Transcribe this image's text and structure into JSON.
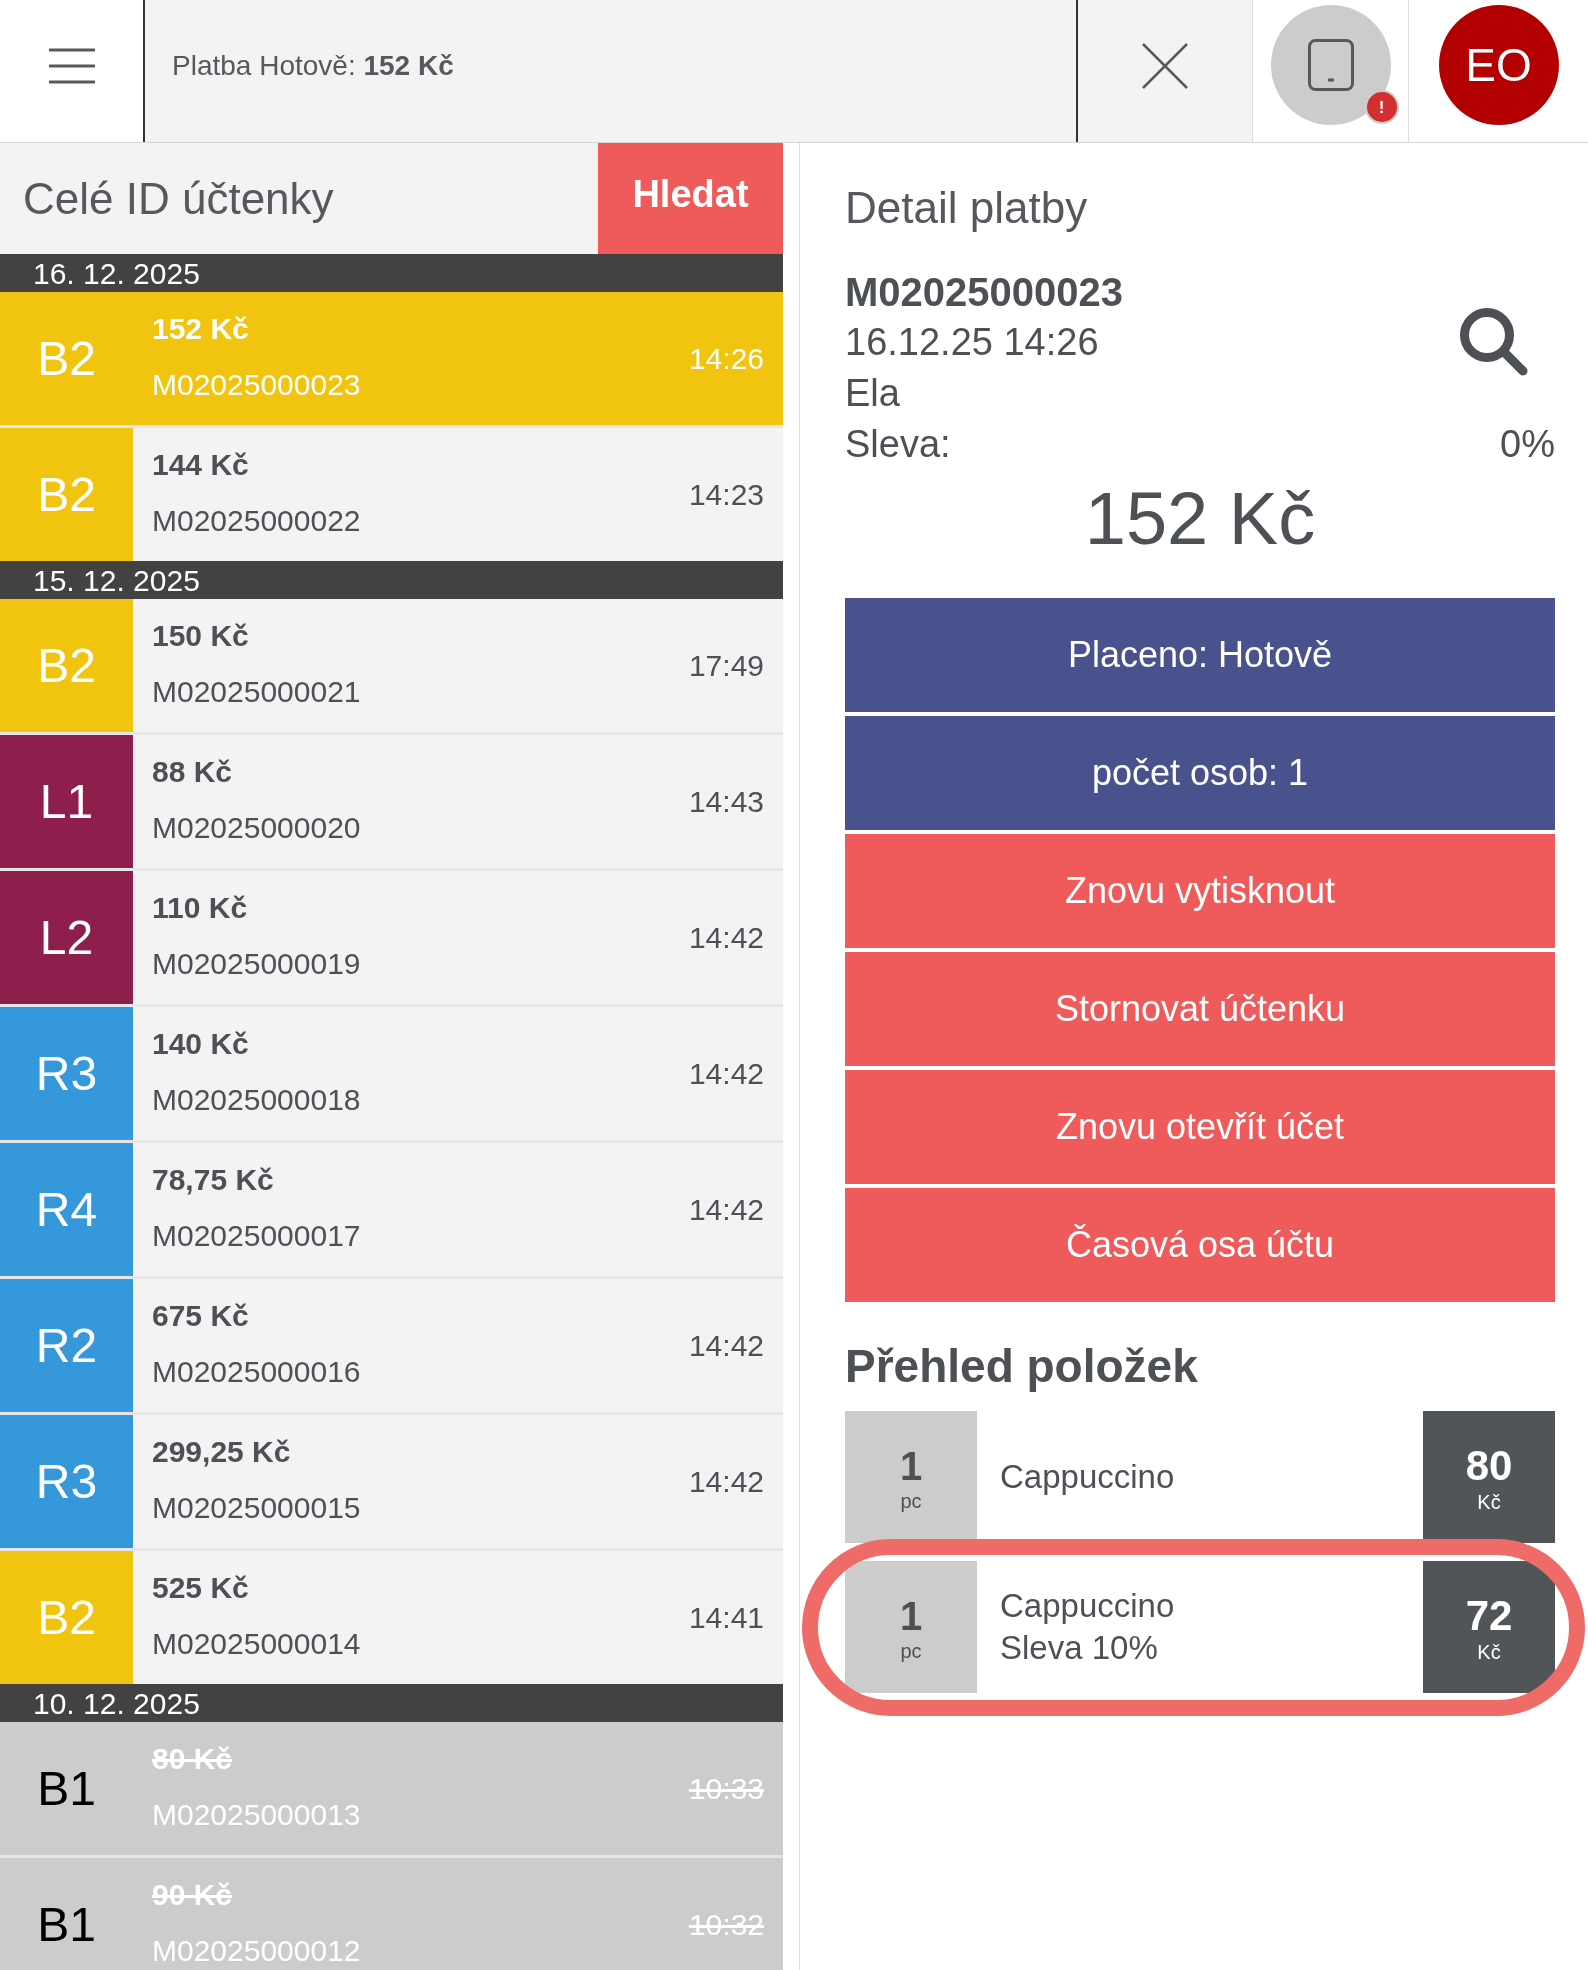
{
  "top_bar": {
    "title": "Platba Hotově: **152 Kč**",
    "device_badge": "!",
    "avatar": "EO"
  },
  "search": {
    "placeholder": "Celé ID účtenky",
    "button": "Hledat"
  },
  "receipt_groups": [
    {
      "date": "16. 12. 2025",
      "receipts": [
        {
          "table": "B2",
          "color": "#f1c40f",
          "amount": "152 Kč",
          "id": "M02025000023",
          "time": "14:26",
          "selected": true,
          "voided": false
        },
        {
          "table": "B2",
          "color": "#f1c40f",
          "amount": "144 Kč",
          "id": "M02025000022",
          "time": "14:23",
          "selected": false,
          "voided": false
        }
      ]
    },
    {
      "date": "15. 12. 2025",
      "receipts": [
        {
          "table": "B2",
          "color": "#f1c40f",
          "amount": "150 Kč",
          "id": "M02025000021",
          "time": "17:49",
          "selected": false,
          "voided": false
        },
        {
          "table": "L1",
          "color": "#8e1e4b",
          "amount": "88 Kč",
          "id": "M02025000020",
          "time": "14:43",
          "selected": false,
          "voided": false
        },
        {
          "table": "L2",
          "color": "#8e1e4b",
          "amount": "110 Kč",
          "id": "M02025000019",
          "time": "14:42",
          "selected": false,
          "voided": false
        },
        {
          "table": "R3",
          "color": "#3598db",
          "amount": "140 Kč",
          "id": "M02025000018",
          "time": "14:42",
          "selected": false,
          "voided": false
        },
        {
          "table": "R4",
          "color": "#3598db",
          "amount": "78,75 Kč",
          "id": "M02025000017",
          "time": "14:42",
          "selected": false,
          "voided": false
        },
        {
          "table": "R2",
          "color": "#3598db",
          "amount": "675 Kč",
          "id": "M02025000016",
          "time": "14:42",
          "selected": false,
          "voided": false
        },
        {
          "table": "R3",
          "color": "#3598db",
          "amount": "299,25 Kč",
          "id": "M02025000015",
          "time": "14:42",
          "selected": false,
          "voided": false
        },
        {
          "table": "B2",
          "color": "#f1c40f",
          "amount": "525 Kč",
          "id": "M02025000014",
          "time": "14:41",
          "selected": false,
          "voided": false
        }
      ]
    },
    {
      "date": "10. 12. 2025",
      "receipts": [
        {
          "table": "B1",
          "color": "#cccccc",
          "amount": "80 Kč",
          "id": "M02025000013",
          "time": "10:33",
          "selected": false,
          "voided": true
        },
        {
          "table": "B1",
          "color": "#cccccc",
          "amount": "90 Kč",
          "id": "M02025000012",
          "time": "10:32",
          "selected": false,
          "voided": true
        }
      ]
    }
  ],
  "detail": {
    "title": "Detail platby",
    "receipt_id": "M02025000023",
    "datetime": "16.12.25 14:26",
    "staff": "Ela",
    "discount_label": "Sleva:",
    "discount_value": "0%",
    "total": "152 Kč",
    "actions": [
      {
        "label": "Placeno: Hotově",
        "kind": "info"
      },
      {
        "label": "počet osob: 1",
        "kind": "info"
      },
      {
        "label": "Znovu vytisknout",
        "kind": "danger"
      },
      {
        "label": "Stornovat účtenku",
        "kind": "danger"
      },
      {
        "label": "Znovu otevřít účet",
        "kind": "danger"
      },
      {
        "label": "Časová osa účtu",
        "kind": "danger"
      }
    ],
    "items_title": "Přehled položek",
    "items": [
      {
        "qty": "1",
        "unit": "pc",
        "name": "Cappuccino",
        "price": "80",
        "currency": "Kč",
        "highlighted": false
      },
      {
        "qty": "1",
        "unit": "pc",
        "name": "Cappuccino",
        "note": "Sleva 10%",
        "price": "72",
        "currency": "Kč",
        "highlighted": true
      }
    ]
  }
}
